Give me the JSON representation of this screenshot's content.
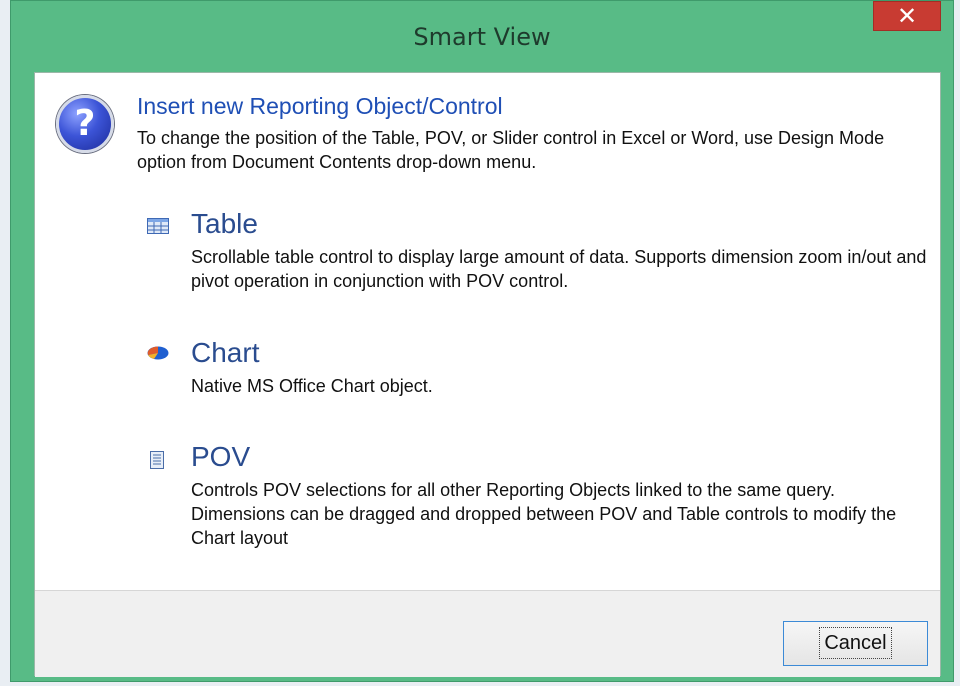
{
  "window": {
    "title": "Smart View",
    "close_label": "✕"
  },
  "header": {
    "icon": "question-icon",
    "title": "Insert new Reporting Object/Control",
    "description": "To change the position of the Table, POV, or Slider control in Excel or Word, use Design Mode option from Document Contents drop-down menu."
  },
  "options": [
    {
      "icon": "table-icon",
      "title": "Table",
      "description": "Scrollable table control to display large amount of data. Supports dimension zoom in/out and pivot operation in conjunction with POV control."
    },
    {
      "icon": "chart-icon",
      "title": "Chart",
      "description": "Native MS Office Chart object."
    },
    {
      "icon": "pov-icon",
      "title": "POV",
      "description": "Controls POV selections for all other Reporting Objects linked to the same query. Dimensions can be dragged and dropped between POV and Table controls to modify the Chart layout"
    }
  ],
  "footer": {
    "cancel_label": "Cancel"
  },
  "colors": {
    "window_frame": "#58bb86",
    "close_button": "#c83b32",
    "link_title": "#1f4fb5"
  }
}
